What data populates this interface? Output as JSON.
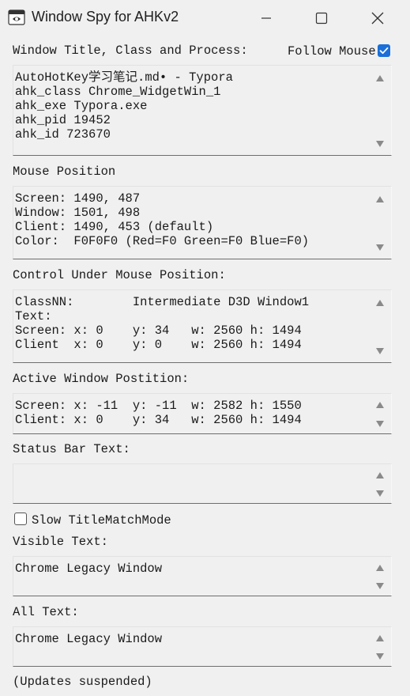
{
  "window": {
    "title": "Window Spy for AHKv2",
    "icon": "spy-icon",
    "controls": {
      "minimize": "minimize-icon",
      "maximize": "maximize-icon",
      "close": "close-icon"
    }
  },
  "sections": {
    "window_info": {
      "label": "Window Title, Class and Process:",
      "follow_mouse_label": "Follow Mouse",
      "follow_mouse_checked": true,
      "text": "AutoHotKey学习笔记.md• - Typora\nahk_class Chrome_WidgetWin_1\nahk_exe Typora.exe\nahk_pid 19452\nahk_id 723670"
    },
    "mouse_position": {
      "label": "Mouse Position",
      "text": "Screen: 1490, 487\nWindow: 1501, 498\nClient: 1490, 453 (default)\nColor:  F0F0F0 (Red=F0 Green=F0 Blue=F0)"
    },
    "control_under_mouse": {
      "label": "Control Under Mouse Position:",
      "text": "ClassNN:        Intermediate D3D Window1\nText:\nScreen: x: 0    y: 34   w: 2560 h: 1494\nClient  x: 0    y: 0    w: 2560 h: 1494"
    },
    "active_window": {
      "label": "Active Window Postition:",
      "text": "Screen: x: -11  y: -11  w: 2582 h: 1550\nClient: x: 0    y: 34   w: 2560 h: 1494"
    },
    "status_bar": {
      "label": "Status Bar Text:",
      "text": ""
    },
    "slow_mode": {
      "label": "Slow TitleMatchMode",
      "checked": false
    },
    "visible_text": {
      "label": "Visible Text:",
      "text": "Chrome Legacy Window"
    },
    "all_text": {
      "label": "All Text:",
      "text": "Chrome Legacy Window"
    }
  },
  "footer": {
    "status": "(Updates suspended)"
  },
  "colors": {
    "background": "#f0f0f0",
    "checkbox_accent": "#1a6fd8",
    "text": "#1a1a1a"
  }
}
